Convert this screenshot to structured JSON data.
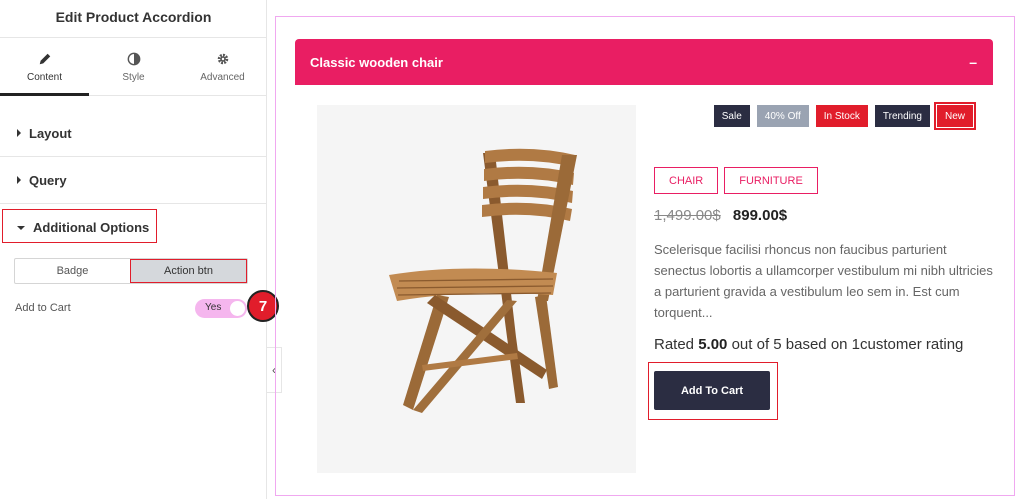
{
  "panel": {
    "title": "Edit Product Accordion",
    "tabs": [
      {
        "label": "Content",
        "icon": "pencil-icon",
        "active": true
      },
      {
        "label": "Style",
        "icon": "contrast-icon",
        "active": false
      },
      {
        "label": "Advanced",
        "icon": "gear-icon",
        "active": false
      }
    ],
    "sections": [
      {
        "label": "Layout",
        "expanded": false
      },
      {
        "label": "Query",
        "expanded": false
      },
      {
        "label": "Additional Options",
        "expanded": true
      }
    ],
    "segments": [
      {
        "label": "Badge",
        "active": false
      },
      {
        "label": "Action btn",
        "active": true
      }
    ],
    "add_to_cart": {
      "label": "Add to Cart",
      "toggle_text": "Yes",
      "on": true
    },
    "step_badge": "7"
  },
  "preview": {
    "accordion_title": "Classic wooden chair",
    "toggle_symbol": "–",
    "badges": [
      {
        "label": "Sale",
        "color": "#2b2d42"
      },
      {
        "label": "40% Off",
        "color": "#9aa3b2"
      },
      {
        "label": "In Stock",
        "color": "#e11d2b"
      },
      {
        "label": "Trending",
        "color": "#2b2d42"
      },
      {
        "label": "New",
        "color": "#e11d2b"
      }
    ],
    "categories": [
      "CHAIR",
      "FURNITURE"
    ],
    "old_price": "1,499.00$",
    "new_price": "899.00$",
    "description": "Scelerisque facilisi rhoncus non faucibus parturient senectus lobortis a ullamcorper vestibulum mi nibh ultricies a parturient gravida a vestibulum leo sem in. Est cum torquent...",
    "rating": {
      "prefix": "Rated",
      "value": "5.00",
      "suffix": "out of 5 based on 1customer rating"
    },
    "cart_button": "Add To Cart"
  },
  "colors": {
    "accent": "#e91e63",
    "highlight": "#e11d2b",
    "dark": "#2b2d42"
  }
}
